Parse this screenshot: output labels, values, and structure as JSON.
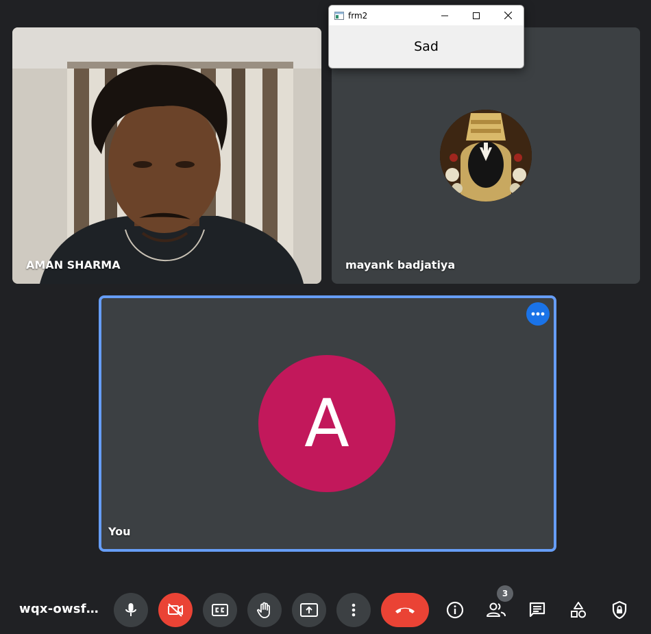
{
  "popup": {
    "title": "frm2",
    "body_text": "Sad"
  },
  "participants": {
    "aman": {
      "name": "AMAN SHARMA"
    },
    "mayank": {
      "name": "mayank badjatiya"
    },
    "you": {
      "name": "You",
      "avatar_initial": "A",
      "avatar_color": "#c2185b"
    }
  },
  "bottom_bar": {
    "meeting_code": "wqx-owsf…",
    "people_count": "3"
  },
  "colors": {
    "background": "#202124",
    "tile": "#3c4043",
    "active_border": "#669df6",
    "danger": "#ea4335",
    "accent": "#1a73e8"
  }
}
